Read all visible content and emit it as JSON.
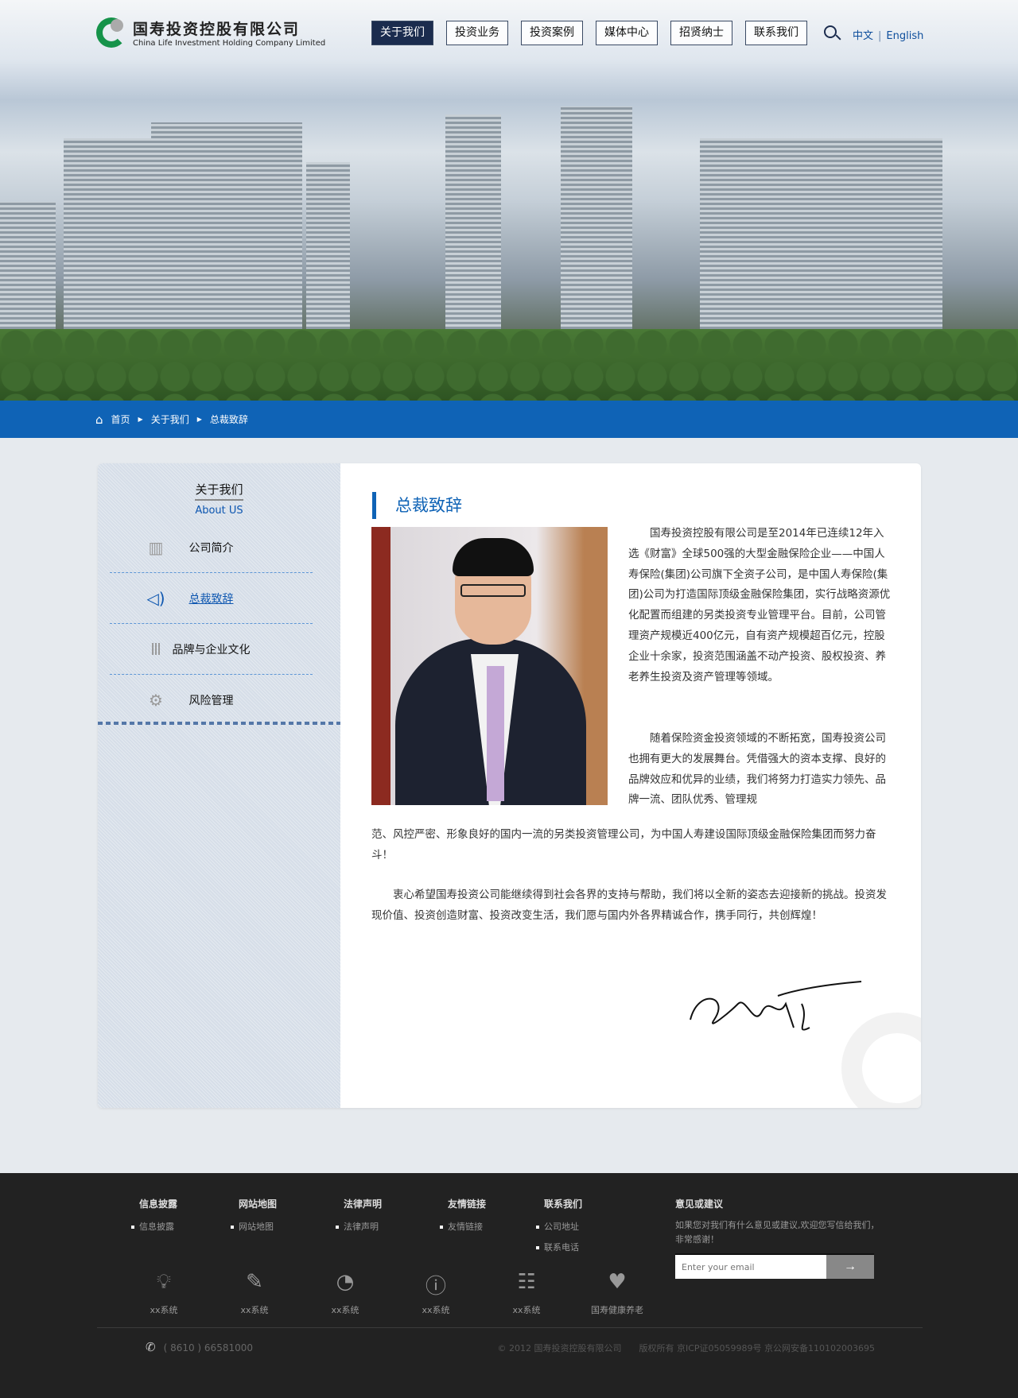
{
  "header": {
    "logo_cn": "国寿投资控股有限公司",
    "logo_en": "China Life Investment Holding Company Limited",
    "nav": [
      "关于我们",
      "投资业务",
      "投资案例",
      "媒体中心",
      "招贤纳士",
      "联系我们"
    ],
    "lang_cn": "中文",
    "lang_en": "English"
  },
  "breadcrumb": [
    "首页",
    "关于我们",
    "总裁致辞"
  ],
  "sidebar": {
    "title": "关于我们",
    "subtitle": "About US",
    "items": [
      {
        "label": "公司简介",
        "icon": "building-icon"
      },
      {
        "label": "总裁致辞",
        "icon": "speaker-icon"
      },
      {
        "label": "品牌与企业文化",
        "icon": "pillar-icon"
      },
      {
        "label": "风险管理",
        "icon": "plug-gear-icon"
      }
    ]
  },
  "main": {
    "title": "总裁致辞",
    "paragraphs": [
      "国寿投资控股有限公司是至2014年已连续12年入选《财富》全球500强的大型金融保险企业——中国人寿保险(集团)公司旗下全资子公司，是中国人寿保险(集团)公司为打造国际顶级金融保险集团，实行战略资源优化配置而组建的另类投资专业管理平台。目前，公司管理资产规模近400亿元，自有资产规模超百亿元，控股企业十余家，投资范围涵盖不动产投资、股权投资、养老养生投资及资产管理等领域。",
      "随着保险资金投资领域的不断拓宽，国寿投资公司也拥有更大的发展舞台。凭借强大的资本支撑、良好的品牌效应和优异的业绩，我们将努力打造实力领先、品牌一流、团队优秀、管理规",
      "范、风控严密、形象良好的国内一流的另类投资管理公司，为中国人寿建设国际顶级金融保险集团而努力奋斗！",
      "衷心希望国寿投资公司能继续得到社会各界的支持与帮助，我们将以全新的姿态去迎接新的挑战。投资发现价值、投资创造财富、投资改变生活，我们愿与国内外各界精诚合作，携手同行，共创辉煌！"
    ]
  },
  "footer": {
    "cols": [
      {
        "title": "信息披露",
        "items": [
          "信息披露"
        ]
      },
      {
        "title": "网站地图",
        "items": [
          "网站地图"
        ]
      },
      {
        "title": "法律声明",
        "items": [
          "法律声明"
        ]
      },
      {
        "title": "友情链接",
        "items": [
          "友情链接"
        ]
      },
      {
        "title": "联系我们",
        "items": [
          "公司地址",
          "联系电话"
        ]
      }
    ],
    "suggest_title": "意见或建议",
    "suggest_text": "如果您对我们有什么意见或建议,欢迎您写信给我们，非常感谢！",
    "email_placeholder": "Enter your email",
    "systems": [
      {
        "label": "xx系统",
        "icon": "lightbulb-icon"
      },
      {
        "label": "xx系统",
        "icon": "edit-icon"
      },
      {
        "label": "xx系统",
        "icon": "pie-chart-icon"
      },
      {
        "label": "xx系统",
        "icon": "info-icon"
      },
      {
        "label": "xx系统",
        "icon": "list-icon"
      },
      {
        "label": "国寿健康养老",
        "icon": "heart-icon"
      }
    ],
    "phone": "( 8610 ) 66581000",
    "copyright": "© 2012 国寿投资控股有限公司　　版权所有 京ICP证05059989号 京公网安备110102003695"
  }
}
